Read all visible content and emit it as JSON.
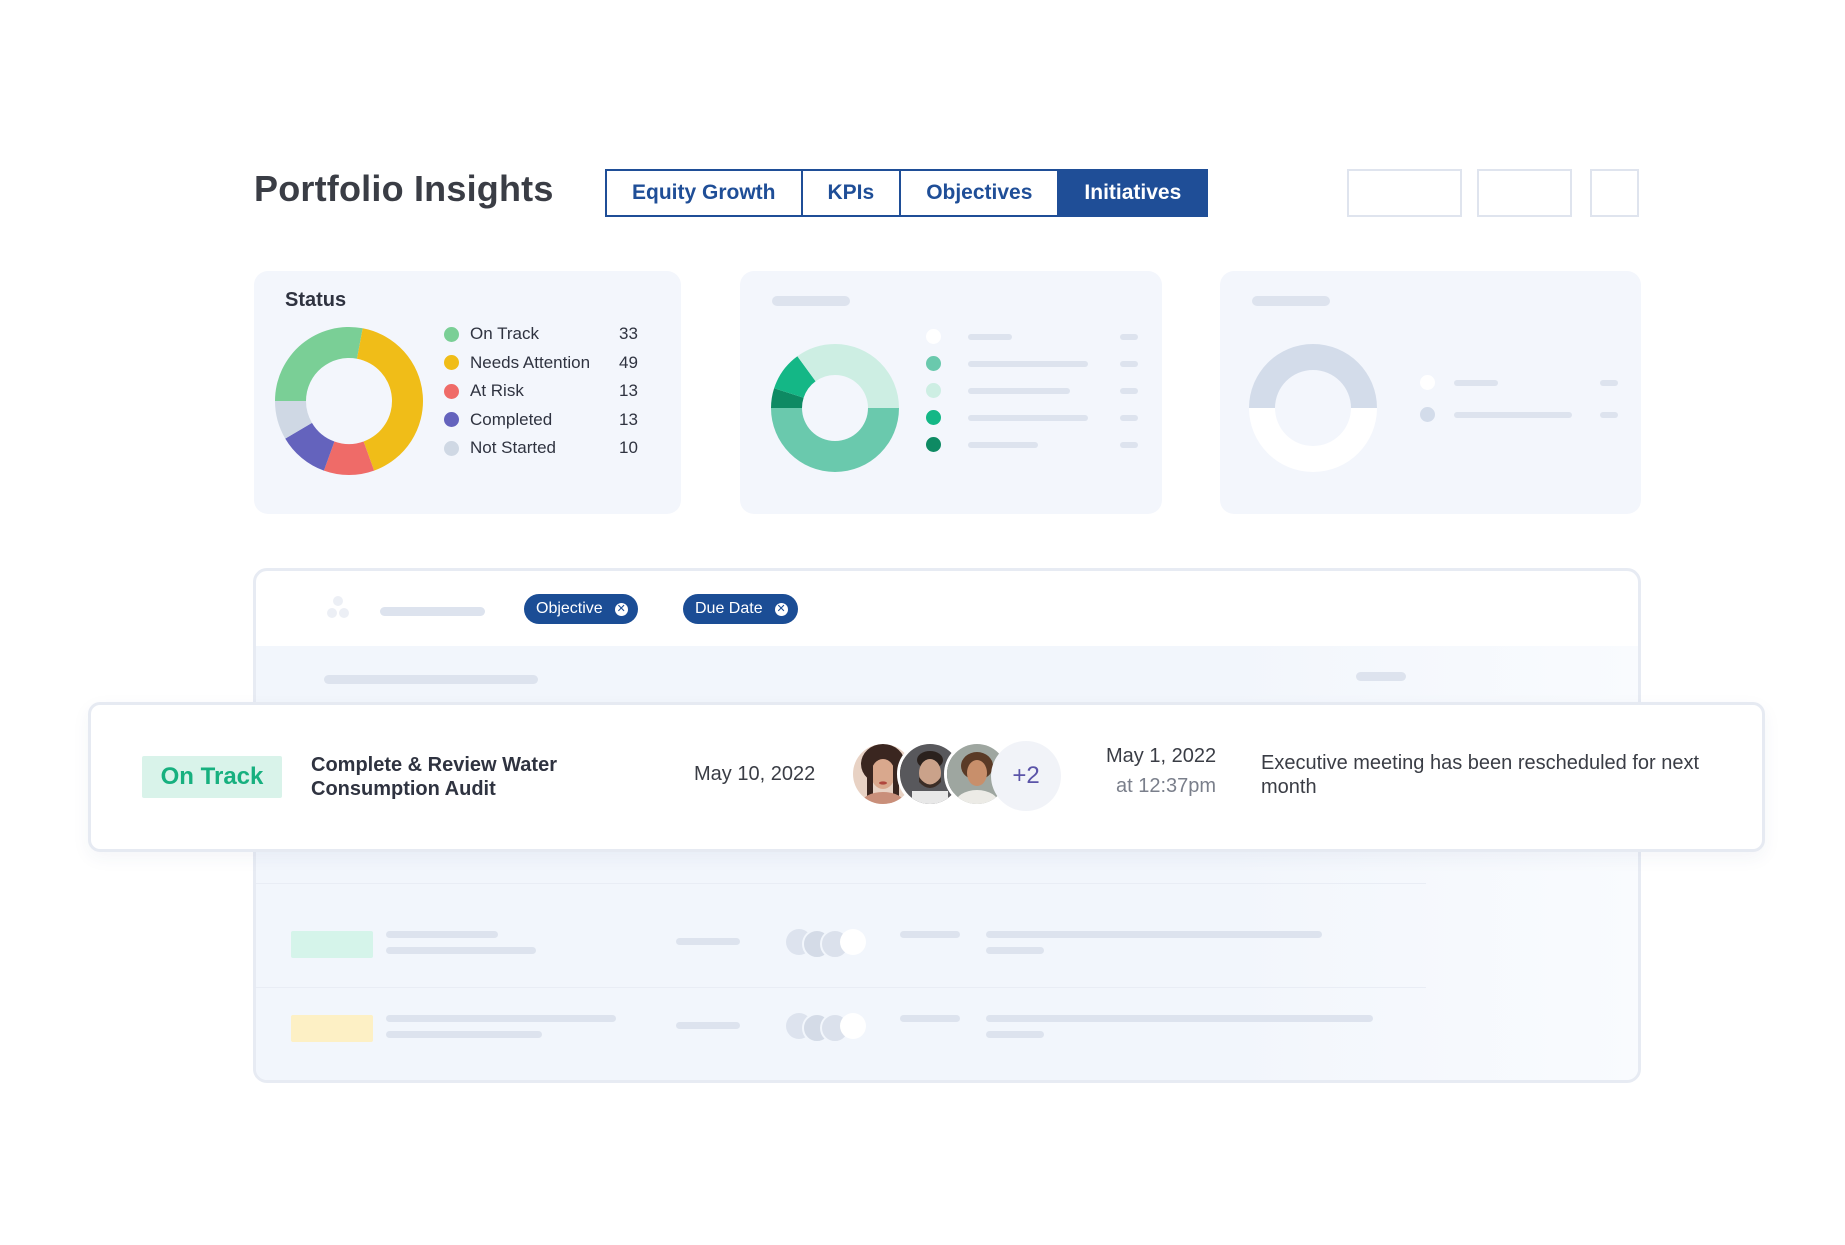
{
  "header": {
    "title": "Portfolio Insights",
    "tabs": [
      {
        "label": "Equity Growth",
        "active": false
      },
      {
        "label": "KPIs",
        "active": false
      },
      {
        "label": "Objectives",
        "active": false
      },
      {
        "label": "Initiatives",
        "active": true
      }
    ]
  },
  "status_card": {
    "title": "Status",
    "legend": [
      {
        "label": "On Track",
        "value": "33",
        "color": "#7acf96"
      },
      {
        "label": "Needs Attention",
        "value": "49",
        "color": "#f0bd18"
      },
      {
        "label": "At Risk",
        "value": "13",
        "color": "#ef6b68"
      },
      {
        "label": "Completed",
        "value": "13",
        "color": "#6463bd"
      },
      {
        "label": "Not Started",
        "value": "10",
        "color": "#cfd8e4"
      }
    ]
  },
  "chart_data": {
    "type": "pie",
    "variant": "donut",
    "title": "Status",
    "categories": [
      "On Track",
      "Needs Attention",
      "At Risk",
      "Completed",
      "Not Started"
    ],
    "values": [
      33,
      49,
      13,
      13,
      10
    ],
    "colors": [
      "#7acf96",
      "#f0bd18",
      "#ef6b68",
      "#6463bd",
      "#cfd8e4"
    ],
    "legend_position": "right"
  },
  "placeholder_colors": {
    "green_series": [
      "#ffffff",
      "#6ac9ad",
      "#cdeee3",
      "#14b786",
      "#0e8a63"
    ],
    "grey_series": [
      "#ffffff",
      "#d3dcea"
    ]
  },
  "filters": {
    "chips": [
      {
        "label": "Objective",
        "remove_icon": "close-circle-icon"
      },
      {
        "label": "Due Date",
        "remove_icon": "close-circle-icon"
      }
    ]
  },
  "highlighted_row": {
    "status": "On Track",
    "status_color": "#17b07f",
    "title": "Complete & Review Water Consumption Audit",
    "due_date": "May 10, 2022",
    "extra_assignees": "+2",
    "updated_date": "May 1, 2022",
    "updated_time": "at 12:37pm",
    "note": "Executive meeting has been rescheduled for next month"
  }
}
